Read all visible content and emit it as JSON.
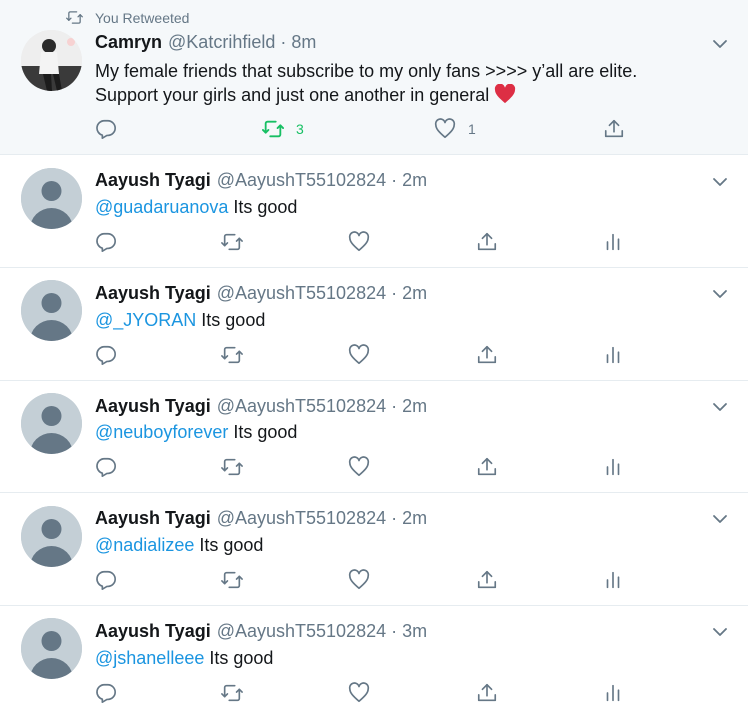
{
  "retweet_banner": "You Retweeted",
  "tweets": [
    {
      "name": "Camryn",
      "handle": "@Katcrihfield",
      "separator": "·",
      "time": "8m",
      "text_line1": "My female friends that subscribe to my only fans >>>> y’all are elite.",
      "text_line2": "Support your girls and just one another in general",
      "emoji": "red-heart-emoji",
      "retweet_count": "3",
      "like_count": "1",
      "retweet_color": "#17bf63"
    },
    {
      "name": "Aayush Tyagi",
      "handle": "@AayushT55102824",
      "separator": "·",
      "time": "2m",
      "mention": "@guadaruanova",
      "body": " Its good"
    },
    {
      "name": "Aayush Tyagi",
      "handle": "@AayushT55102824",
      "separator": "·",
      "time": "2m",
      "mention": "@_JYORAN",
      "body": " Its good"
    },
    {
      "name": "Aayush Tyagi",
      "handle": "@AayushT55102824",
      "separator": "·",
      "time": "2m",
      "mention": "@neuboyforever",
      "body": " Its good"
    },
    {
      "name": "Aayush Tyagi",
      "handle": "@AayushT55102824",
      "separator": "·",
      "time": "2m",
      "mention": "@nadializee",
      "body": " Its good"
    },
    {
      "name": "Aayush Tyagi",
      "handle": "@AayushT55102824",
      "separator": "·",
      "time": "3m",
      "mention": "@jshanelleee",
      "body": " Its good"
    }
  ],
  "colors": {
    "accent": "#1b95e0",
    "muted": "#657786",
    "retweet_active": "#17bf63",
    "heart_emoji": "#dd2e44"
  },
  "icons": [
    "retweet-icon",
    "reply-icon",
    "like-icon",
    "share-icon",
    "analytics-icon",
    "chevron-down-icon"
  ]
}
